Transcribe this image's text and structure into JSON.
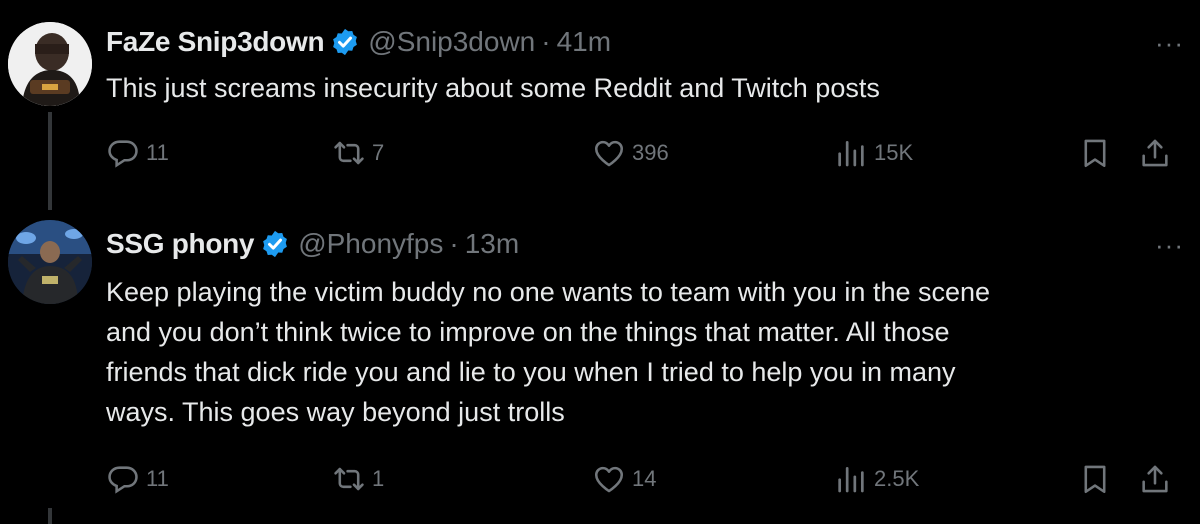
{
  "tweets": [
    {
      "name": "FaZe Snip3down",
      "handle": "@Snip3down",
      "separator": "·",
      "time": "41m",
      "text": "This just screams insecurity about some Reddit and Twitch posts",
      "replies": "11",
      "reposts": "7",
      "likes": "396",
      "views": "15K",
      "more": "···"
    },
    {
      "name": "SSG phony",
      "handle": "@Phonyfps",
      "separator": "·",
      "time": "13m",
      "text": "Keep playing the victim buddy no one wants to team with you in the scene\nand you don’t think twice to improve on the things that matter. All those\nfriends that dick ride you and lie to you when I tried to help you in many\nways. This goes way beyond just trolls",
      "replies": "11",
      "reposts": "1",
      "likes": "14",
      "views": "2.5K",
      "more": "···"
    }
  ],
  "icons": {
    "reply": "reply-icon",
    "repost": "repost-icon",
    "like": "heart-icon",
    "views": "views-icon",
    "bookmark": "bookmark-icon",
    "share": "share-icon",
    "verified": "verified-badge-icon"
  },
  "colors": {
    "background": "#000000",
    "text_primary": "#e7e9ea",
    "text_secondary": "#71767b",
    "verified_blue": "#1d9bf0",
    "thread_line": "#333639"
  }
}
